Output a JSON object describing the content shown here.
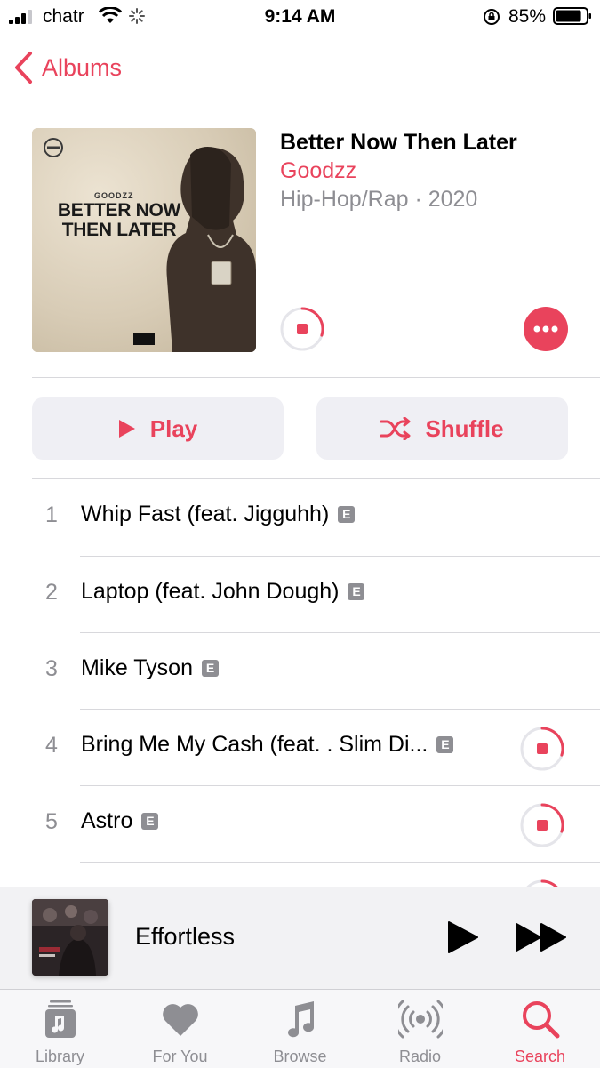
{
  "status_bar": {
    "carrier": "chatr",
    "time": "9:14 AM",
    "battery": "85%",
    "battery_level": 0.85,
    "icons": [
      "signal-icon",
      "wifi-icon",
      "activity-spinner-icon",
      "rotation-lock-icon",
      "battery-icon"
    ]
  },
  "nav": {
    "back_label": "Albums"
  },
  "album": {
    "title": "Better Now Then Later",
    "artist": "Goodzz",
    "meta": "Hip-Hop/Rap · 2020",
    "cover": {
      "brand": "GOODZZ",
      "title": "BETTER NOW THEN LATER"
    }
  },
  "actions": {
    "play_label": "Play",
    "shuffle_label": "Shuffle"
  },
  "tracks": [
    {
      "number": "1",
      "title": "Whip Fast (feat. Jigguhh)",
      "explicit": "E",
      "downloading": false
    },
    {
      "number": "2",
      "title": "Laptop (feat. John Dough)",
      "explicit": "E",
      "downloading": false
    },
    {
      "number": "3",
      "title": "Mike Tyson",
      "explicit": "E",
      "downloading": false
    },
    {
      "number": "4",
      "title": "Bring Me My Cash (feat. . Slim Di...",
      "explicit": "E",
      "downloading": true
    },
    {
      "number": "5",
      "title": "Astro",
      "explicit": "E",
      "downloading": true
    }
  ],
  "now_playing": {
    "title": "Effortless"
  },
  "tabs": [
    {
      "label": "Library",
      "icon": "library-icon",
      "active": false
    },
    {
      "label": "For You",
      "icon": "heart-icon",
      "active": false
    },
    {
      "label": "Browse",
      "icon": "music-note-icon",
      "active": false
    },
    {
      "label": "Radio",
      "icon": "radio-icon",
      "active": false
    },
    {
      "label": "Search",
      "icon": "search-icon",
      "active": true
    }
  ],
  "colors": {
    "accent": "#e9435c",
    "secondary_text": "#8e8e93",
    "button_bg": "#efeff4"
  }
}
